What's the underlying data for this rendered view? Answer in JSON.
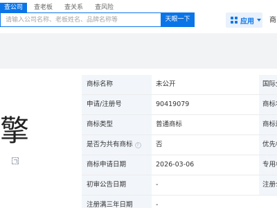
{
  "header": {
    "tabs": [
      "查公司",
      "查老板",
      "查关系",
      "查风险"
    ],
    "search": {
      "placeholder": "请输入公司名称、老板姓名、品牌名称等",
      "value": ""
    },
    "search_button": "天眼一下",
    "apps_label": "应用",
    "more_label": "商"
  },
  "logo": {
    "glyph": "擎"
  },
  "table": {
    "rows": [
      {
        "label": "商标名称",
        "value": "未公开",
        "side": "国际分"
      },
      {
        "label": "申请/注册号",
        "value": "90419079",
        "side": "商标状"
      },
      {
        "label": "商标类型",
        "value": "普通商标",
        "side": "商标形"
      },
      {
        "label": "是否为共有商标",
        "help": "?",
        "value": "否",
        "side": "优先权"
      },
      {
        "label": "商标申请日期",
        "value": "2026-03-06",
        "side": "专用权"
      },
      {
        "label": "初审公告日期",
        "value": "-",
        "side": "注册公"
      },
      {
        "label": "注册满三年日期",
        "value": "-",
        "side": ""
      }
    ]
  }
}
